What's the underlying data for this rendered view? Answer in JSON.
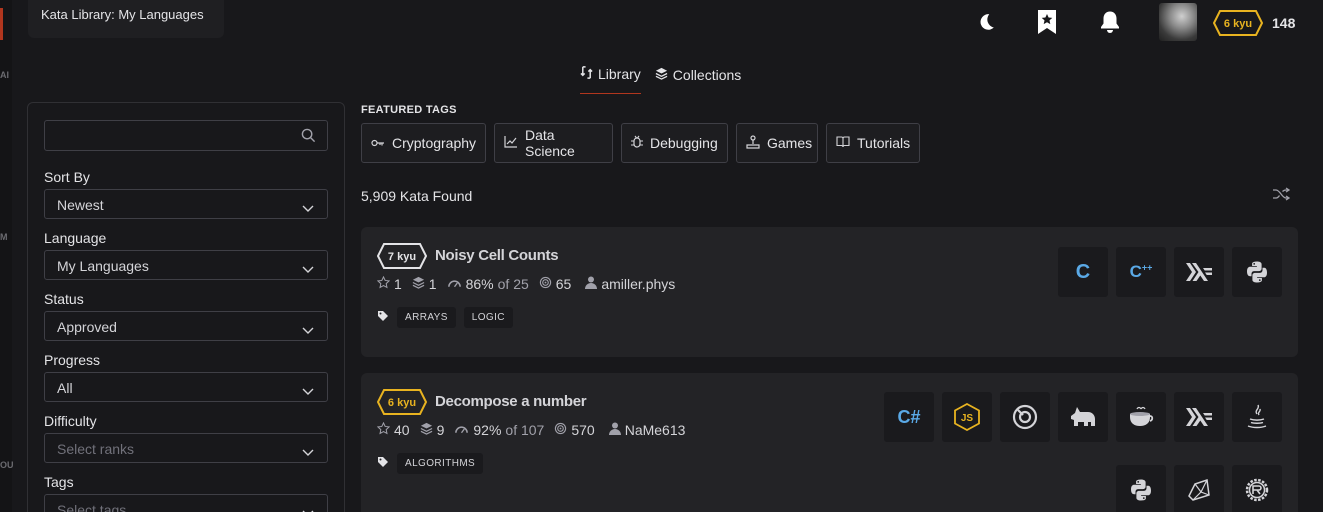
{
  "page_title": "Kata Library: My Languages",
  "top_bar": {
    "honor": "148",
    "rank": "6 kyu",
    "icons": [
      "moon-icon",
      "bookmark-star-icon",
      "bell-icon",
      "avatar"
    ]
  },
  "tabs": [
    {
      "label": "Library",
      "icon": "library-icon",
      "active": true
    },
    {
      "label": "Collections",
      "icon": "layers-icon",
      "active": false
    }
  ],
  "filters": {
    "search_placeholder": "",
    "sort_by": {
      "label": "Sort By",
      "value": "Newest"
    },
    "language": {
      "label": "Language",
      "value": "My Languages"
    },
    "status": {
      "label": "Status",
      "value": "Approved"
    },
    "progress": {
      "label": "Progress",
      "value": "All"
    },
    "difficulty": {
      "label": "Difficulty",
      "placeholder": "Select ranks"
    },
    "tags": {
      "label": "Tags",
      "placeholder": "Select tags"
    }
  },
  "featured": {
    "label": "FEATURED TAGS",
    "tags": [
      {
        "label": "Cryptography",
        "icon": "key-icon"
      },
      {
        "label": "Data Science",
        "icon": "chart-line-icon"
      },
      {
        "label": "Debugging",
        "icon": "bug-icon"
      },
      {
        "label": "Games",
        "icon": "joystick-icon"
      },
      {
        "label": "Tutorials",
        "icon": "book-icon"
      }
    ]
  },
  "results": {
    "count_text": "5,909 Kata Found"
  },
  "kata": [
    {
      "rank": "7 kyu",
      "title": "Noisy Cell Counts",
      "stars": "1",
      "collections": "1",
      "satisfaction": "86%",
      "of_votes": "of 25",
      "completed": "65",
      "author": "amiller.phys",
      "tags": [
        "ARRAYS",
        "LOGIC"
      ],
      "languages": [
        "C",
        "C++",
        "Haskell",
        "Python"
      ]
    },
    {
      "rank": "6 kyu",
      "title": "Decompose a number",
      "stars": "40",
      "collections": "9",
      "satisfaction": "92%",
      "of_votes": "of 107",
      "completed": "570",
      "author": "NaMe613",
      "tags": [
        "ALGORITHMS"
      ],
      "languages": [
        "C#",
        "JavaScript",
        "Crystal",
        "CoffeeScript",
        "Elixir",
        "Haskell",
        "Java",
        "Python",
        "Ruby",
        "Rust"
      ]
    }
  ],
  "colors": {
    "bg": "#18181b",
    "card": "#232326",
    "accent": "#b1361e",
    "rank_6kyu": "#e8b320",
    "rank_7kyu": "#e4e4e7",
    "c_blue": "#5aa9e6"
  }
}
